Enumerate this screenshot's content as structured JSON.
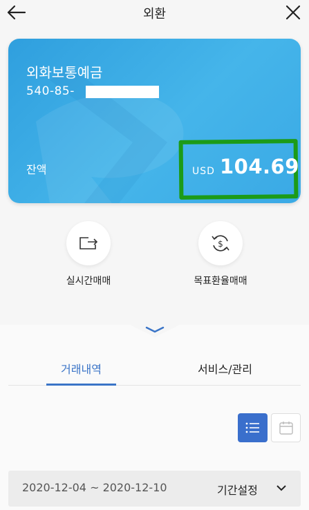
{
  "header": {
    "title": "외환",
    "back_icon": "arrow-left-icon",
    "close_icon": "close-icon"
  },
  "account": {
    "name": "외화보통예금",
    "number_visible": "540-85-",
    "balance_label": "잔액",
    "currency": "USD",
    "amount": "104.69",
    "card_color": "#38aae4",
    "highlight_color": "#1c9b18"
  },
  "actions": [
    {
      "label": "실시간매매",
      "icon": "exchange-transfer-icon"
    },
    {
      "label": "목표환율매매",
      "icon": "dollar-cycle-icon"
    }
  ],
  "tabs": [
    {
      "label": "거래내역",
      "active": true
    },
    {
      "label": "서비스/관리",
      "active": false
    }
  ],
  "view_toggle": {
    "selected": "list",
    "list_icon": "list-icon",
    "calendar_icon": "calendar-icon"
  },
  "filter": {
    "date_range": "2020-12-04 ~ 2020-12-10",
    "period_label": "기간설정"
  },
  "colors": {
    "accent": "#3a74c7",
    "button_blue": "#3a6fcc"
  }
}
